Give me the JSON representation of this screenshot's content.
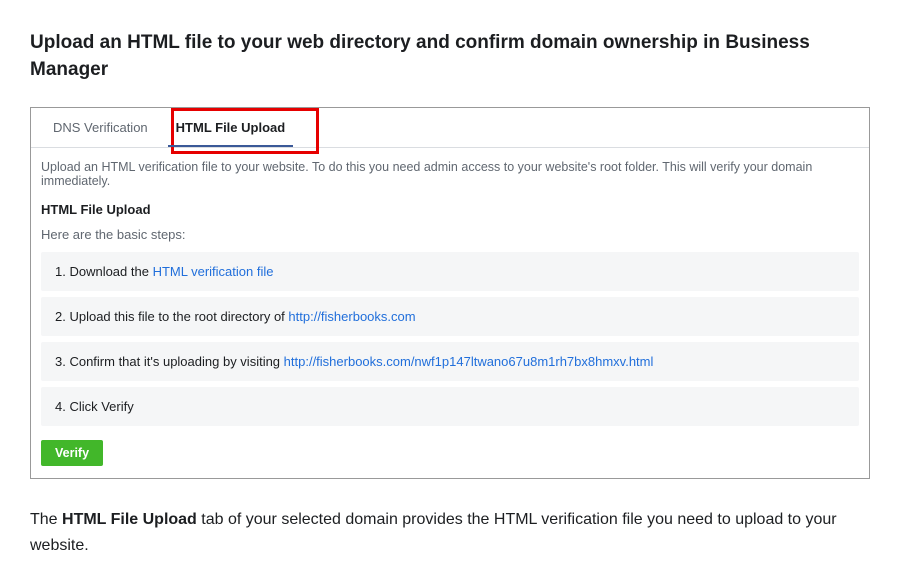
{
  "title": "Upload an HTML file to your web directory and confirm domain ownership in Business Manager",
  "tabs": {
    "dns": "DNS Verification",
    "html": "HTML File Upload"
  },
  "intro": "Upload an HTML verification file to your website. To do this you need admin access to your website's root folder. This will verify your domain immediately.",
  "subHeading": "HTML File Upload",
  "stepsIntro": "Here are the basic steps:",
  "steps": {
    "s1_prefix": "1. Download the ",
    "s1_link": "HTML verification file",
    "s2_prefix": "2. Upload this file to the root directory of ",
    "s2_link": "http://fisherbooks.com",
    "s3_prefix": "3. Confirm that it's uploading by visiting ",
    "s3_link": "http://fisherbooks.com/nwf1p147ltwano67u8m1rh7bx8hmxv.html",
    "s4": "4. Click Verify"
  },
  "verifyLabel": "Verify",
  "footer": {
    "pre": "The ",
    "bold": "HTML File Upload",
    "post": " tab of your selected domain provides the HTML verification file you need to upload to your website."
  }
}
